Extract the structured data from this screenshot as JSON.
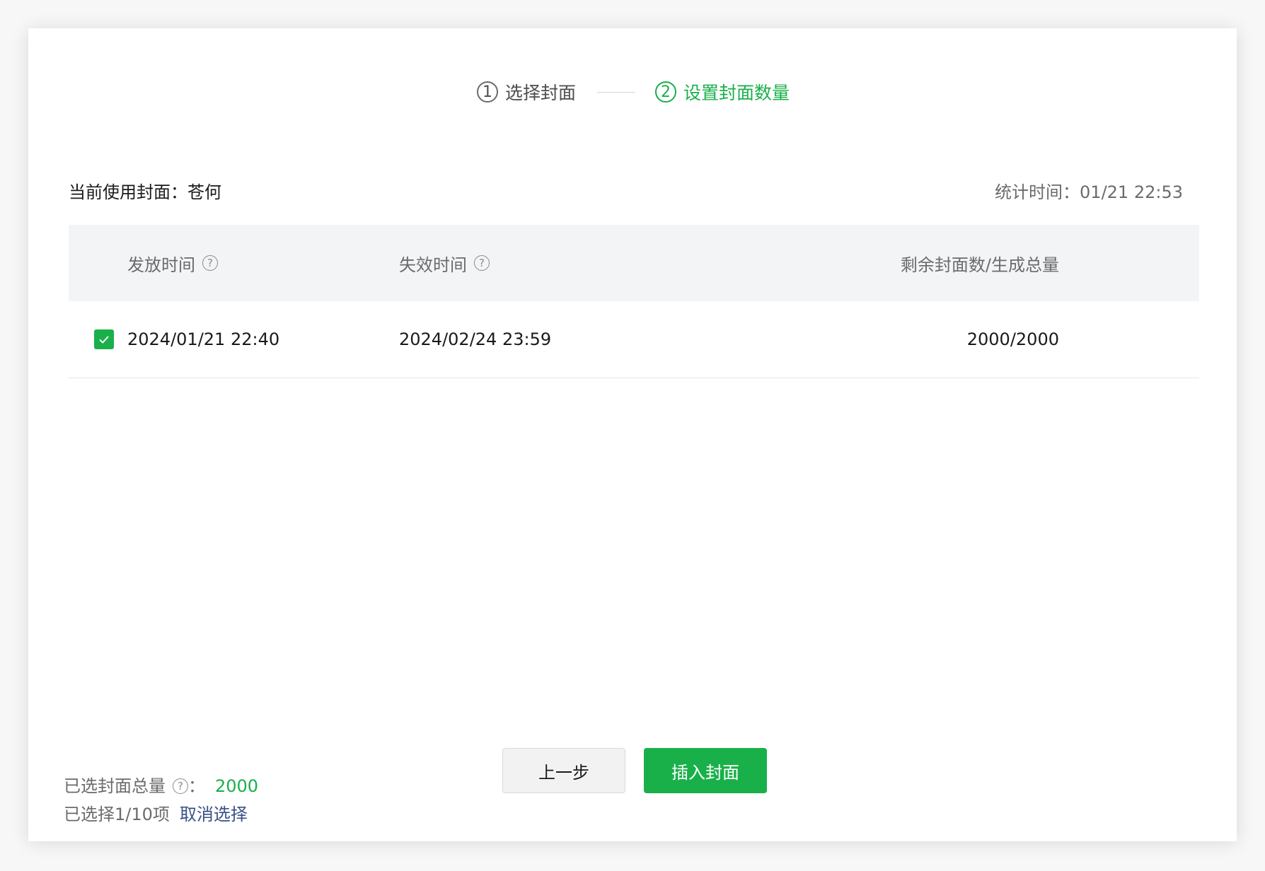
{
  "steps": [
    {
      "number": "1",
      "label": "选择封面",
      "state": "done"
    },
    {
      "number": "2",
      "label": "设置封面数量",
      "state": "active"
    }
  ],
  "info": {
    "current_cover": "当前使用封面：苍何",
    "stat_time": "统计时间：01/21 22:53"
  },
  "table": {
    "headers": {
      "issue_time": "发放时间",
      "expire_time": "失效时间",
      "remaining": "剩余封面数/生成总量"
    },
    "rows": [
      {
        "checked": true,
        "issue_time": "2024/01/21 22:40",
        "expire_time": "2024/02/24 23:59",
        "remaining": "2000/2000"
      }
    ]
  },
  "footer": {
    "total_label": "已选封面总量",
    "total_sep": "：",
    "total_value": "2000",
    "selected_text": "已选择1/10项",
    "cancel_link": "取消选择",
    "prev_button": "上一步",
    "insert_button": "插入封面"
  },
  "help_glyph": "?",
  "colors": {
    "accent": "#19b04a",
    "link": "#3a5186",
    "header_bg": "#f3f4f6"
  }
}
